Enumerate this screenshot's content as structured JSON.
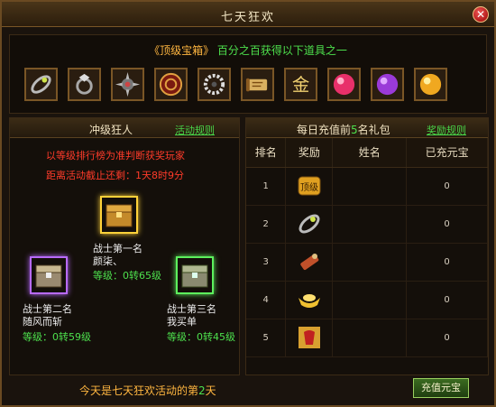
{
  "window": {
    "title": "七天狂欢",
    "close_label": "✕"
  },
  "banner": {
    "prize_part1": "《顶级宝箱》",
    "prize_part2": "百分之百获得以下道具之一",
    "items": [
      "bracelet-icon",
      "ring-icon",
      "spiked-armor-icon",
      "medal-icon",
      "bead-necklace-icon",
      "scroll-icon",
      "gold-character-icon",
      "red-gem-icon",
      "purple-gem-icon",
      "yellow-gem-icon"
    ]
  },
  "left_panel": {
    "title": "冲级狂人",
    "rules_link": "活动规则",
    "desc": "以等级排行榜为准判断获奖玩家",
    "countdown": "距离活动截止还剩：1天8时9分",
    "first": {
      "role": "战士第一名",
      "name": "颜柒、",
      "level": "等级：0转65级"
    },
    "second": {
      "role": "战士第二名",
      "name": "随风而斩",
      "level": "等级：0转59级"
    },
    "third": {
      "role": "战士第三名",
      "name": "我买单",
      "level": "等级：0转45级"
    }
  },
  "right_panel": {
    "title_pre": "每日充值前",
    "title_num": "5",
    "title_post": "名礼包",
    "rules_link": "奖励规则",
    "headers": [
      "排名",
      "奖励",
      "姓名",
      "已充元宝"
    ],
    "rows": [
      {
        "rank": "1",
        "reward_icon": "top-grade-token-icon",
        "reward_label": "顶级",
        "name": "",
        "amount": "0"
      },
      {
        "rank": "2",
        "reward_icon": "bracelet-icon",
        "name": "",
        "amount": "0"
      },
      {
        "rank": "3",
        "reward_icon": "scroll-icon",
        "name": "",
        "amount": "0"
      },
      {
        "rank": "4",
        "reward_icon": "gold-ingot-icon",
        "name": "",
        "amount": "0"
      },
      {
        "rank": "5",
        "reward_icon": "red-pouch-icon",
        "name": "",
        "amount": "0"
      }
    ]
  },
  "footer": {
    "text_pre": "今天是七天狂欢活动的第",
    "day": "2",
    "text_post": "天",
    "recharge_button": "充值元宝"
  }
}
